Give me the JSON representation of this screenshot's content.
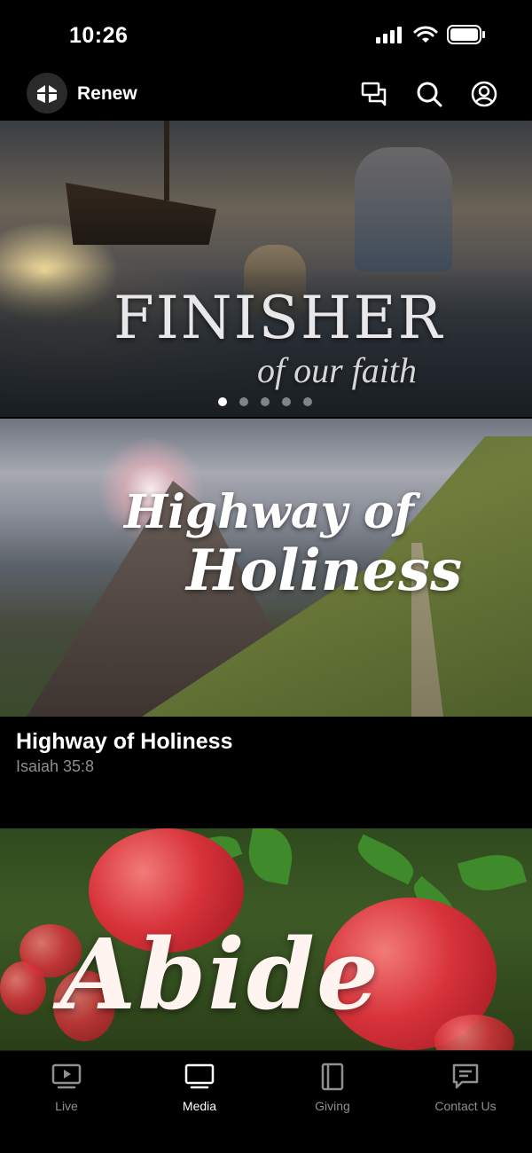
{
  "status_bar": {
    "time": "10:26",
    "icons": [
      "signal-icon",
      "wifi-icon",
      "battery-icon"
    ]
  },
  "header": {
    "app_name": "Renew",
    "actions": [
      "chat-icon",
      "search-icon",
      "profile-icon"
    ]
  },
  "hero": {
    "title": "FINISHER",
    "subtitle": "of our faith",
    "page_count": 5,
    "active_page": 1
  },
  "media_items": [
    {
      "art_line1": "Highway of",
      "art_line2": "Holiness",
      "title": "Highway of Holiness",
      "subtitle": "Isaiah 35:8"
    },
    {
      "art_text": "Abide"
    }
  ],
  "tabs": [
    {
      "label": "Live",
      "icon": "play-screen-icon",
      "active": false
    },
    {
      "label": "Media",
      "icon": "monitor-icon",
      "active": true
    },
    {
      "label": "Giving",
      "icon": "book-icon",
      "active": false
    },
    {
      "label": "Contact Us",
      "icon": "message-icon",
      "active": false
    }
  ],
  "colors": {
    "background": "#000000",
    "text": "#ffffff",
    "secondary_text": "#8e8e93"
  }
}
